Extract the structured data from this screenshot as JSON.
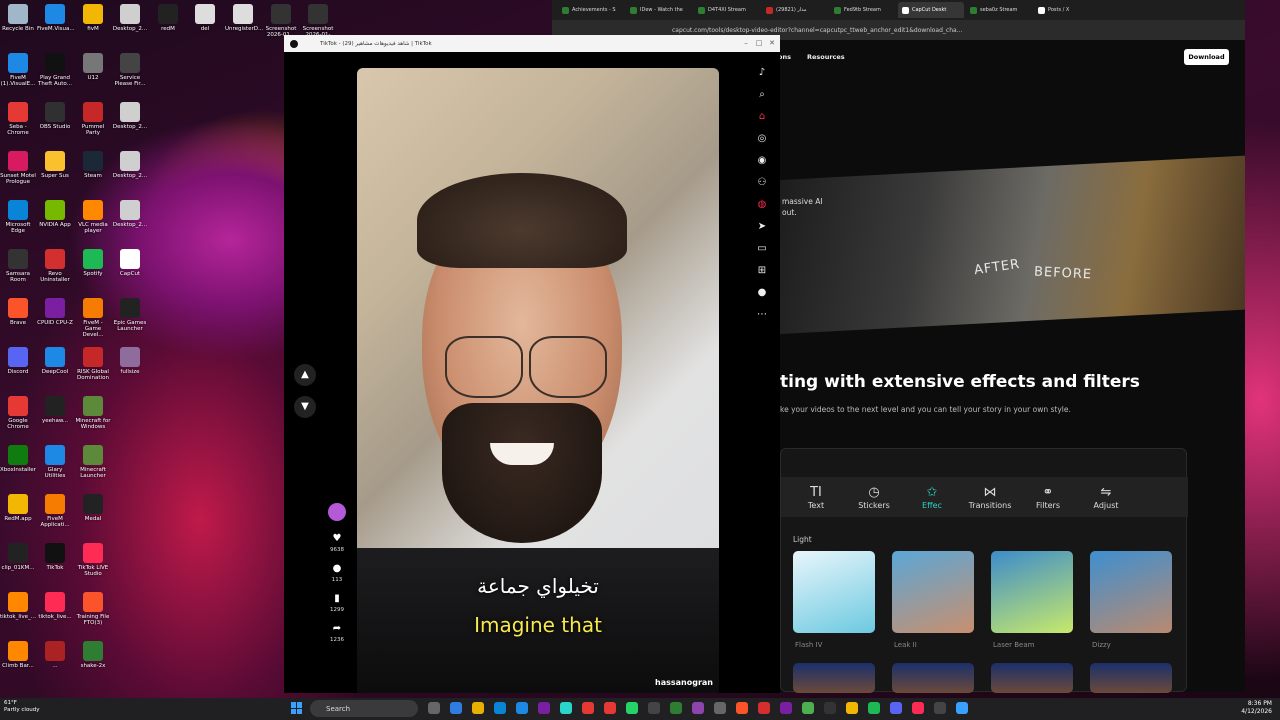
{
  "desktop": {
    "icons": [
      {
        "label": "Recycle Bin",
        "color": "#9fb7c9"
      },
      {
        "label": "FiveM.Visua...",
        "color": "#1e88e5"
      },
      {
        "label": "fivM",
        "color": "#f2b705"
      },
      {
        "label": "Desktop_2...",
        "color": "#cfcfcf"
      },
      {
        "label": "redM",
        "color": "#222222"
      },
      {
        "label": "del",
        "color": "#dddddd"
      },
      {
        "label": "UnregisterD...",
        "color": "#dddddd"
      },
      {
        "label": "Screenshot 2026-01...",
        "color": "#333333"
      },
      {
        "label": "Screenshot 2026-01-27...",
        "color": "#333333"
      },
      {
        "label": "FiveM (1).VisualE...",
        "color": "#1e88e5"
      },
      {
        "label": "Play Grand Theft Auto...",
        "color": "#111111"
      },
      {
        "label": "U12",
        "color": "#777777"
      },
      {
        "label": "Service Please Fir...",
        "color": "#444444"
      },
      {
        "label": "Seba - Chrome",
        "color": "#e53935"
      },
      {
        "label": "OBS Studio",
        "color": "#303030"
      },
      {
        "label": "Pummel Party",
        "color": "#c62828"
      },
      {
        "label": "Desktop_2...",
        "color": "#cfcfcf"
      },
      {
        "label": "Sunset Motel Prologue",
        "color": "#d81b60"
      },
      {
        "label": "Super Sus",
        "color": "#fbc02d"
      },
      {
        "label": "Steam",
        "color": "#1b2838"
      },
      {
        "label": "Desktop_2...",
        "color": "#cfcfcf"
      },
      {
        "label": "Microsoft Edge",
        "color": "#0a84d6"
      },
      {
        "label": "NVIDIA App",
        "color": "#76b900"
      },
      {
        "label": "VLC media player",
        "color": "#ff8800"
      },
      {
        "label": "Desktop_2...",
        "color": "#cfcfcf"
      },
      {
        "label": "Samsara Room",
        "color": "#333333"
      },
      {
        "label": "Revo Uninstaller",
        "color": "#d32f2f"
      },
      {
        "label": "Spotify",
        "color": "#1db954"
      },
      {
        "label": "CapCut",
        "color": "#ffffff"
      },
      {
        "label": "Brave",
        "color": "#fb542b"
      },
      {
        "label": "CPUID CPU-Z",
        "color": "#7b1fa2"
      },
      {
        "label": "FiveM - Game Devel...",
        "color": "#f57c00"
      },
      {
        "label": "Epic Games Launcher",
        "color": "#222222"
      },
      {
        "label": "Discord",
        "color": "#5865f2"
      },
      {
        "label": "DeepCool",
        "color": "#1e88e5"
      },
      {
        "label": "RISK Global Domination",
        "color": "#c62828"
      },
      {
        "label": "fullsize",
        "color": "#8e6d9c"
      },
      {
        "label": "Google Chrome",
        "color": "#e53935"
      },
      {
        "label": "yeehaw...",
        "color": "#222222"
      },
      {
        "label": "Minecraft for Windows",
        "color": "#5d8a3a"
      },
      {
        "label": "XboxInstaller",
        "color": "#107c10"
      },
      {
        "label": "Glary Utilities",
        "color": "#1e88e5"
      },
      {
        "label": "Minecraft Launcher",
        "color": "#5d8a3a"
      },
      {
        "label": "RedM.app",
        "color": "#f2b705"
      },
      {
        "label": "FiveM Applicati...",
        "color": "#f57c00"
      },
      {
        "label": "Medal",
        "color": "#222222"
      },
      {
        "label": "clip_01KM...",
        "color": "#222222"
      },
      {
        "label": "TikTok",
        "color": "#111111"
      },
      {
        "label": "TikTok LIVE Studio",
        "color": "#fe2c55"
      },
      {
        "label": "tiktok_live_...",
        "color": "#ff8800"
      },
      {
        "label": "tiktok_live...",
        "color": "#fe2c55"
      },
      {
        "label": "Training File FTO(3)",
        "color": "#fb542b"
      },
      {
        "label": "Climb Bar...",
        "color": "#ff8800"
      },
      {
        "label": "...",
        "color": "#aa2222"
      },
      {
        "label": "shake-2x",
        "color": "#2e7d32"
      }
    ]
  },
  "browser_right": {
    "tabs": [
      {
        "label": "Achievements - S",
        "color": "#2e7d32",
        "active": false
      },
      {
        "label": "IDew - Watch the",
        "color": "#2e7d32",
        "active": false
      },
      {
        "label": "D4T4XI Stream",
        "color": "#2e7d32",
        "active": false
      },
      {
        "label": "مدار (29821)",
        "color": "#c62828",
        "active": false
      },
      {
        "label": "Fed9tb Stream",
        "color": "#2e7d32",
        "active": false
      },
      {
        "label": "CapCut Deskt",
        "color": "#ffffff",
        "active": true
      },
      {
        "label": "seba0z Stream",
        "color": "#2e7d32",
        "active": false
      },
      {
        "label": "Posts / X",
        "color": "#ffffff",
        "active": false
      }
    ],
    "url": "capcut.com/tools/desktop-video-editor?channel=capcutpc_ttweb_anchor_edit1&download_cha...",
    "nav": [
      "ons",
      "Resources"
    ],
    "download_label": "Download",
    "hero_text": "massive AI out.",
    "hero_after": "AFTER",
    "hero_before": "BEFORE",
    "heading": "ting with extensive effects and filters",
    "subheading": "ke your videos to the next level and you can tell your story in your own style.",
    "editor": {
      "toolbar": [
        {
          "label": "Text",
          "icon": "TI"
        },
        {
          "label": "Stickers",
          "icon": "◷"
        },
        {
          "label": "Effec",
          "icon": "✩",
          "active": true
        },
        {
          "label": "Transitions",
          "icon": "⋈"
        },
        {
          "label": "Filters",
          "icon": "⚭"
        },
        {
          "label": "Adjust",
          "icon": "⇋"
        }
      ],
      "section_label": "Light",
      "effects": [
        {
          "label": "Flash IV",
          "color_a": "#e8f6fb",
          "color_b": "#6cc9e0"
        },
        {
          "label": "Leak II",
          "color_a": "#5aa7d6",
          "color_b": "#c98f6e"
        },
        {
          "label": "Laser Beam",
          "color_a": "#3d8ccb",
          "color_b": "#c7e96a"
        },
        {
          "label": "Dizzy",
          "color_a": "#3e8fd0",
          "color_b": "#b98a70"
        }
      ]
    }
  },
  "browser_left": {
    "title": "TikTok - (29) شاهد فيديوهات مشاهير | TikTok",
    "video": {
      "caption_arabic": "تخيلواي جماعة",
      "caption_english": "Imagine that",
      "author": "hassanogran"
    },
    "actions": [
      {
        "icon": "♥",
        "count": "9638"
      },
      {
        "icon": "●",
        "count": "113"
      },
      {
        "icon": "▮",
        "count": "1299"
      },
      {
        "icon": "➦",
        "count": "1236"
      }
    ],
    "sidebar_icons": [
      "tiktok-logo",
      "search",
      "home",
      "explore",
      "globe",
      "following",
      "live",
      "messages",
      "inbox",
      "upload",
      "profile",
      "more"
    ]
  },
  "taskbar": {
    "weather_temp": "61°F",
    "weather_desc": "Partly cloudy",
    "search_placeholder": "Search",
    "time": "8:36 PM",
    "date": "4/12/2026"
  }
}
